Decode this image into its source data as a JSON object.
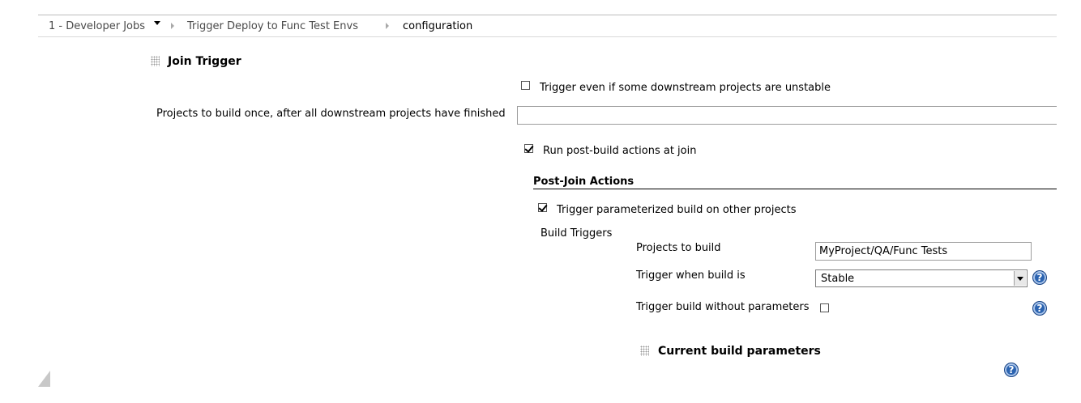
{
  "breadcrumb": {
    "items": [
      "1 - Developer Jobs",
      "Trigger Deploy to Func Test Envs",
      "configuration"
    ]
  },
  "join_trigger": {
    "title": "Join Trigger",
    "unstable_label": "Trigger even if some downstream projects are unstable",
    "unstable_checked": false,
    "projects_label": "Projects to build once, after all downstream projects have finished",
    "projects_value": "",
    "run_postbuild_label": "Run post-build actions at join",
    "run_postbuild_checked": true
  },
  "post_join": {
    "title": "Post-Join Actions",
    "param_trigger_label": "Trigger parameterized build on other projects",
    "param_trigger_checked": true,
    "build_triggers_label": "Build Triggers",
    "projects_to_build_label": "Projects to build",
    "projects_to_build_value": "MyProject/QA/Func Tests",
    "trigger_when_label": "Trigger when build is",
    "trigger_when_value": "Stable",
    "without_params_label": "Trigger build without parameters",
    "without_params_checked": false,
    "current_params_title": "Current build parameters"
  },
  "icons": {
    "help": "?"
  }
}
